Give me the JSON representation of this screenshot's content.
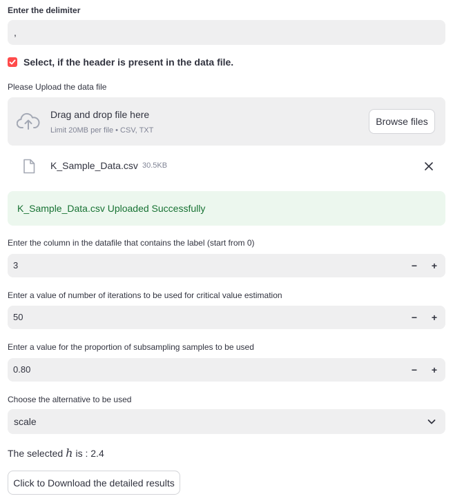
{
  "delimiter": {
    "label": "Enter the delimiter",
    "value": ","
  },
  "header_checkbox": {
    "label": "Select, if the header is present in the data file.",
    "checked": true,
    "accent_color": "#ff4b4b"
  },
  "upload": {
    "label": "Please Upload the data file",
    "drag_text": "Drag and drop file here",
    "limit_text": "Limit 20MB per file • CSV, TXT",
    "browse_label": "Browse files",
    "file_icon": "file-icon",
    "cloud_icon": "cloud-upload-icon"
  },
  "uploaded_file": {
    "name": "K_Sample_Data.csv",
    "size": "30.5KB"
  },
  "success_message": "K_Sample_Data.csv Uploaded Successfully",
  "label_column": {
    "label": "Enter the column in the datafile that contains the label (start from 0)",
    "value": "3"
  },
  "iterations": {
    "label": "Enter a value of number of iterations to be used for critical value estimation",
    "value": "50"
  },
  "proportion": {
    "label": "Enter a value for the proportion of subsampling samples to be used",
    "value": "0.80"
  },
  "stepper": {
    "minus": "−",
    "plus": "+"
  },
  "alternative": {
    "label": "Choose the alternative to be used",
    "value": "scale"
  },
  "result": {
    "prefix": "The selected",
    "variable": "h",
    "suffix": "is : 2.4"
  },
  "download_label": "Click to Download the detailed results"
}
